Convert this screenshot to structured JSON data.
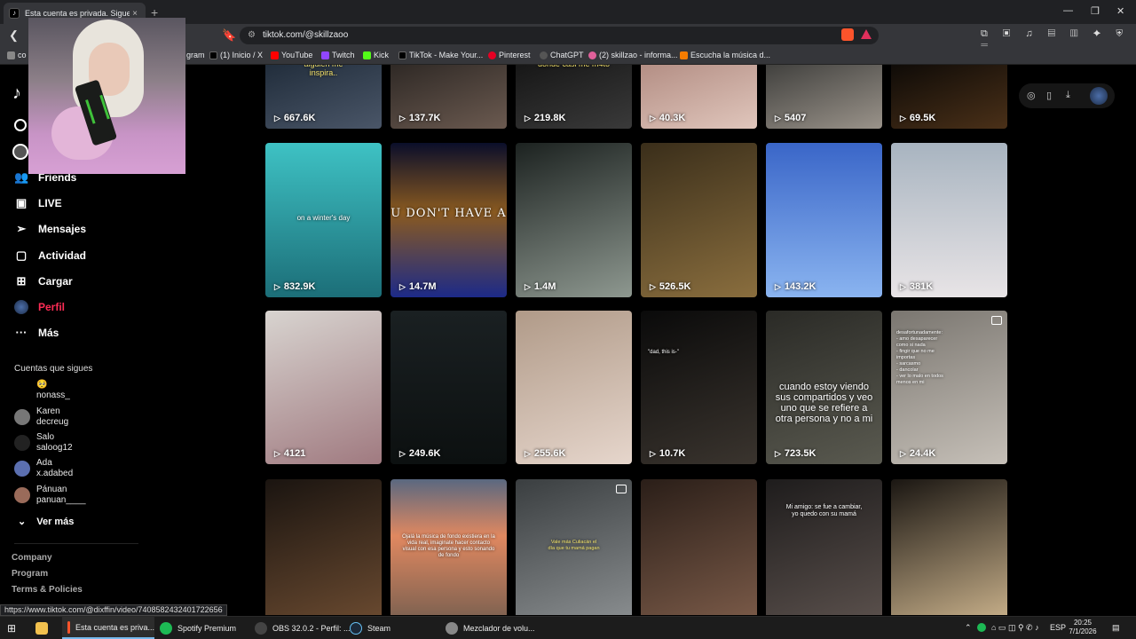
{
  "browser": {
    "tab_title": "Esta cuenta es privada. Sigue es",
    "url": "tiktok.com/@skillzaoo",
    "new_tab": "+",
    "close_tab": "×"
  },
  "bookmarks": [
    {
      "label": "co",
      "color": "#888"
    },
    {
      "label": "gram",
      "color": "#c13584"
    },
    {
      "label": "(1) Inicio / X",
      "color": "#000"
    },
    {
      "label": "YouTube",
      "color": "#ff0000"
    },
    {
      "label": "Twitch",
      "color": "#9146ff"
    },
    {
      "label": "Kick",
      "color": "#53fc18"
    },
    {
      "label": "TikTok - Make Your...",
      "color": "#000"
    },
    {
      "label": "Pinterest",
      "color": "#e60023"
    },
    {
      "label": "ChatGPT",
      "color": "#555"
    },
    {
      "label": "(2) skillzao - informa...",
      "color": "#e0609a"
    },
    {
      "label": "Escucha la música d...",
      "color": "#f57c00"
    }
  ],
  "sidebar": {
    "nav": [
      {
        "label": "Friends",
        "icon": "friends-icon"
      },
      {
        "label": "LIVE",
        "icon": "live-icon"
      },
      {
        "label": "Mensajes",
        "icon": "messages-icon"
      },
      {
        "label": "Actividad",
        "icon": "activity-icon"
      },
      {
        "label": "Cargar",
        "icon": "upload-icon"
      },
      {
        "label": "Perfil",
        "icon": "profile-icon"
      },
      {
        "label": "Más",
        "icon": "more-icon"
      }
    ],
    "following_title": "Cuentas que sigues",
    "following": [
      {
        "name": "",
        "handle": "nonass_",
        "color": "#b08a40"
      },
      {
        "name": "Karen",
        "handle": "decreug",
        "color": "#777"
      },
      {
        "name": "Salo",
        "handle": "saloog12",
        "color": "#222"
      },
      {
        "name": "Ada",
        "handle": "x.adabed",
        "color": "#5b6fb0"
      },
      {
        "name": "Pánuan",
        "handle": "panuan____",
        "color": "#9a6b5a"
      }
    ],
    "see_more": "Ver más",
    "footer": [
      "Company",
      "Program",
      "Terms & Policies"
    ]
  },
  "videos": [
    {
      "views": "667.6K",
      "caption": "alguien me\ninspira..",
      "bg": "linear-gradient(160deg,#1e2a38,#4a5668)"
    },
    {
      "views": "137.7K",
      "caption": "",
      "bg": "linear-gradient(160deg,#2a2522,#6b5a50)"
    },
    {
      "views": "219.8K",
      "caption": "donde casi me m4to",
      "bg": "linear-gradient(160deg,#141414,#3a3a3a)"
    },
    {
      "views": "40.3K",
      "caption": "",
      "bg": "linear-gradient(160deg,#b08a80,#e0c6bc)"
    },
    {
      "views": "5407",
      "caption": "",
      "bg": "linear-gradient(160deg,#3a3a38,#9a938a)"
    },
    {
      "views": "69.5K",
      "caption": "",
      "bg": "linear-gradient(160deg,#0a0806,#4a3018)"
    },
    {
      "views": "832.9K",
      "caption": "on a winter's day",
      "bg": "linear-gradient(180deg,#3ec2c4,#1c6e78)"
    },
    {
      "views": "14.7M",
      "caption": "U DON'T HAVE A",
      "bg": "linear-gradient(180deg,#0a0e2a,#8a5a20 45%,#1c2a88)"
    },
    {
      "views": "1.4M",
      "caption": "",
      "bg": "linear-gradient(160deg,#1c2220,#8e9890)"
    },
    {
      "views": "526.5K",
      "caption": "",
      "bg": "linear-gradient(160deg,#3a2e1a,#8a6e3e)"
    },
    {
      "views": "143.2K",
      "caption": "",
      "bg": "linear-gradient(180deg,#3a66c8,#8ab4f0)"
    },
    {
      "views": "381K",
      "caption": "",
      "bg": "linear-gradient(180deg,#a8b4c0,#e8e4e6)"
    },
    {
      "views": "4121",
      "caption": "",
      "bg": "linear-gradient(160deg,#d8d4d0,#a07a80)"
    },
    {
      "views": "249.6K",
      "caption": "",
      "bg": "linear-gradient(180deg,#1a2022,#0c1010)"
    },
    {
      "views": "255.6K",
      "caption": "",
      "bg": "linear-gradient(160deg,#b09a88,#e6d6cc)"
    },
    {
      "views": "10.7K",
      "caption": "\"dad, this is-\"",
      "bg": "linear-gradient(160deg,#0a0a0a,#3a342e)"
    },
    {
      "views": "723.5K",
      "caption": "cuando estoy viendo sus compartidos y veo uno que se refiere a otra persona y no a mi",
      "bg": "linear-gradient(160deg,#2a2a26,#5a5a50)"
    },
    {
      "views": "24.4K",
      "caption": "desafortunadamente:\n- amo desaparecer\ncomo si nada\n- fingir que no me\nimportas\n- sarcasmo\n- dancolar\n- ver lo malo en todos\nmenos en mi",
      "bg": "linear-gradient(160deg,#7a7670,#c6c0b8)"
    },
    {
      "views": "",
      "caption": "",
      "bg": "linear-gradient(160deg,#1a1410,#6a4a30)"
    },
    {
      "views": "",
      "caption": "Ojalá la música de fondo existiera en la vida real, imaginate hacer contacto visual con esa persona y esto sonando de fondo",
      "bg": "linear-gradient(180deg,#5a6880,#e08860 40%,#7a6050)"
    },
    {
      "views": "",
      "caption": "Vale más Culiacán el día que tu mamá pagan",
      "bg": "linear-gradient(160deg,#3a3e40,#8a8e90)"
    },
    {
      "views": "",
      "caption": "",
      "bg": "linear-gradient(160deg,#2a1e18,#7a5a48)"
    },
    {
      "views": "",
      "caption": "Mi amigo: se fue a cambiar, yo quedo con su mamá",
      "bg": "linear-gradient(160deg,#1e1c1c,#5a504c)"
    },
    {
      "views": "",
      "caption": "",
      "bg": "linear-gradient(160deg,#1a1612,#c8b08a)"
    }
  ],
  "status_url": "https://www.tiktok.com/@dixffin/video/7408582432401722656",
  "taskbar": {
    "items": [
      {
        "label": "Esta cuenta es priva...",
        "color": "#fb542b"
      },
      {
        "label": "Spotify Premium",
        "color": "#1db954"
      },
      {
        "label": "OBS 32.0.2 - Perfil: ...",
        "color": "#444"
      },
      {
        "label": "Steam",
        "color": "#1b2838"
      },
      {
        "label": "Mezclador de volu...",
        "color": "#888"
      }
    ],
    "lang": "ESP",
    "time": "20:25",
    "date": "7/1/2026"
  }
}
